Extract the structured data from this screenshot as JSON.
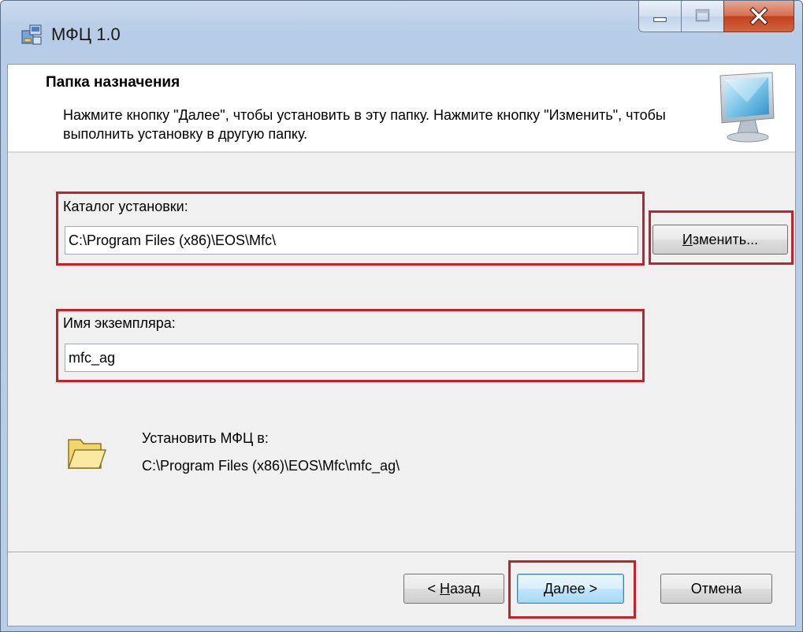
{
  "window": {
    "title": "МФЦ 1.0"
  },
  "banner": {
    "title": "Папка назначения",
    "description": "Нажмите кнопку \"Далее\", чтобы установить в эту папку. Нажмите кнопку \"Изменить\", чтобы выполнить установку в другую папку."
  },
  "install_dir": {
    "label": "Каталог установки:",
    "value": "C:\\Program Files (x86)\\EOS\\Mfc\\",
    "change_button": {
      "prefix": "",
      "mnemonic": "И",
      "rest": "зменить..."
    }
  },
  "instance": {
    "label": "Имя экземпляра:",
    "value": "mfc_ag"
  },
  "summary": {
    "label": "Установить МФЦ в:",
    "path": "C:\\Program Files (x86)\\EOS\\Mfc\\mfc_ag\\"
  },
  "buttons": {
    "back": {
      "prefix": "< ",
      "mnemonic": "Н",
      "rest": "азад"
    },
    "next": {
      "prefix": "",
      "mnemonic": "Д",
      "rest": "алее >"
    },
    "cancel": {
      "label": "Отмена"
    }
  },
  "colors": {
    "highlight": "#c0232b",
    "client_background": "#f0f0f0",
    "banner_background": "#ffffff"
  },
  "icons": {
    "app": "installer-icon",
    "banner": "monitor-icon",
    "folder": "folder-icon"
  }
}
